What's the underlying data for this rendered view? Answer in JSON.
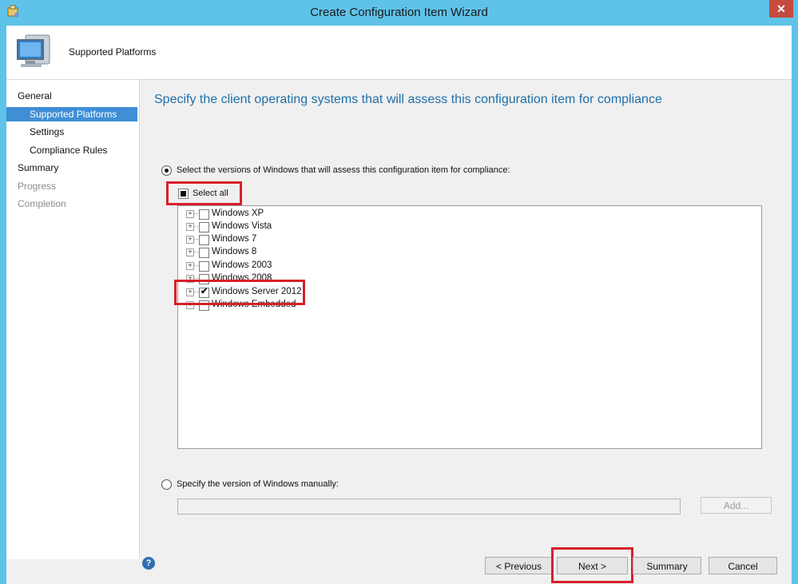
{
  "window": {
    "title": "Create Configuration Item Wizard",
    "close_label": "✕"
  },
  "header": {
    "title": "Supported Platforms"
  },
  "nav": {
    "items": [
      {
        "label": "General"
      },
      {
        "label": "Supported Platforms"
      },
      {
        "label": "Settings"
      },
      {
        "label": "Compliance Rules"
      },
      {
        "label": "Summary"
      },
      {
        "label": "Progress"
      },
      {
        "label": "Completion"
      }
    ]
  },
  "content": {
    "heading": "Specify the client operating systems that will assess this configuration item for compliance",
    "option_versions_label": "Select the versions of Windows that will assess this configuration item for compliance:",
    "select_all_label": "Select all",
    "tree": [
      {
        "label": "Windows XP",
        "checked": false
      },
      {
        "label": "Windows Vista",
        "checked": false
      },
      {
        "label": "Windows 7",
        "checked": false
      },
      {
        "label": "Windows 8",
        "checked": false
      },
      {
        "label": "Windows 2003",
        "checked": false
      },
      {
        "label": "Windows 2008",
        "checked": false
      },
      {
        "label": "Windows Server 2012",
        "checked": true
      },
      {
        "label": "Windows Embedded",
        "checked": false
      }
    ],
    "option_manual_label": "Specify the version of Windows manually:",
    "add_button": "Add..."
  },
  "footer": {
    "help": "?",
    "previous": "< Previous",
    "next": "Next >",
    "summary": "Summary",
    "cancel": "Cancel"
  },
  "colors": {
    "accent": "#3f8ed6",
    "heading": "#1e6fa8",
    "highlight": "#d6202a",
    "frame": "#5fc2e8"
  }
}
